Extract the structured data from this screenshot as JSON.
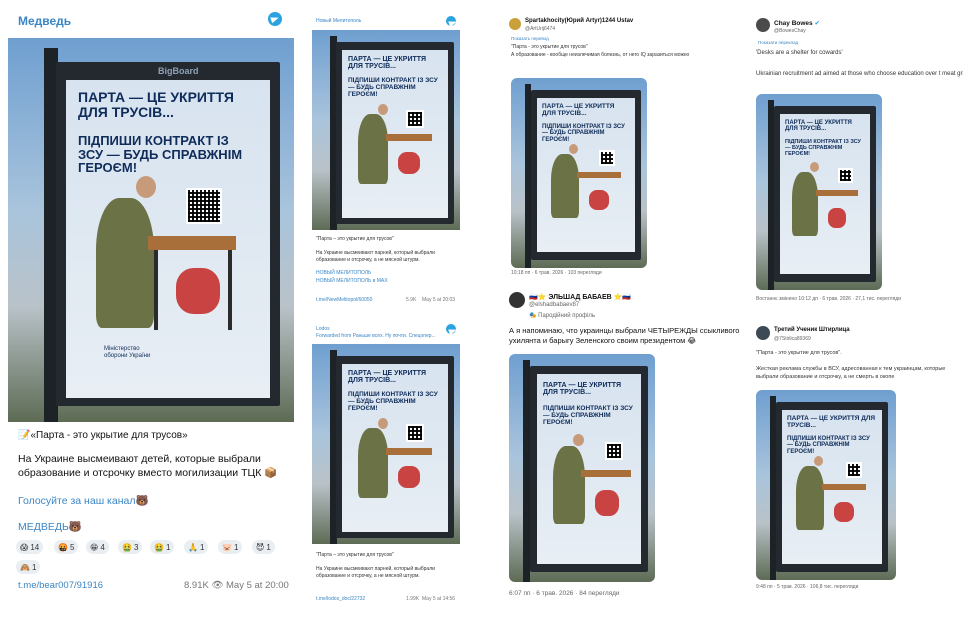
{
  "poster_text": {
    "headline": "ПАРТА — ЦЕ УКРИТТЯ ДЛЯ ТРУСІВ...",
    "sub": "ПІДПИШИ КОНТРАКТ ІЗ ЗСУ — БУДЬ СПРАВЖНІМ ГЕРОЄМ!",
    "ministry": "Міністерство оборони України",
    "board": "BigBoard"
  },
  "panel1": {
    "channel": "Медведь",
    "quote": "«Парта - это укрытие для трусов»",
    "body": "На Украине высмеивают детей, которые выбрали образование и отсрочку вместо могилизации ТЦК",
    "vote_link": "Голосуйте за наш канал",
    "signature": "МЕДВЕДЬ",
    "reactions": [
      {
        "emoji": "😱",
        "count": "14"
      },
      {
        "emoji": "🤬",
        "count": "5"
      },
      {
        "emoji": "😁",
        "count": "4"
      },
      {
        "emoji": "🤮",
        "count": "3"
      },
      {
        "emoji": "🤮",
        "count": "1"
      },
      {
        "emoji": "🙏",
        "count": "1"
      },
      {
        "emoji": "🐷",
        "count": "1"
      },
      {
        "emoji": "😈",
        "count": "1"
      },
      {
        "emoji": "🙈",
        "count": "1"
      }
    ],
    "link": "t.me/bear007/91916",
    "views": "8.91K",
    "date": "May 5 at 20:00"
  },
  "panel2": {
    "channel": "Новый Мелитополь",
    "quote": "\"Парта – это укрытие для трусов\"",
    "body": "На Украине высмеивают парней, который выбрали образование и отсрочку, а не мясной штурм.",
    "extra1": "НОВЫЙ МЕЛИТОПОЛЬ",
    "extra2": "НОВЫЙ МЕЛИТОПОЛЬ в MAX",
    "link": "t.me/NewMelitopol/60050",
    "views": "5.9K",
    "date": "May 5 at 20:03"
  },
  "panel3": {
    "channel": "Lodos",
    "forwarded": "Forwarded from Раньше всех. Ну почти. Спецопер...",
    "quote": "\"Парта – это укрытие для трусов\"",
    "body": "На Украине высмеивают парней, который выбрали образование и отсрочку, а не мясной штурм.",
    "link": "t.me/lodos_doc/22732",
    "views": "1.99K",
    "date": "May 5 at 14:56"
  },
  "panel4": {
    "author": "Spartakhocity(Юрий Artyr)1244 Ustav",
    "handle": "@ArtUrij6474",
    "translate": "Показать перевод",
    "quote": "\"Парта - это укрытие для трусов\"",
    "body": "А образование - вообще неизлечимая болезнь, от него IQ заразиться можно",
    "time": "10:18 пп · 6 трав. 2026 · 103 перегляди"
  },
  "panel5": {
    "author": "ЭЛЬШАД БАБАЕВ",
    "handle": "@elshadbabaev87",
    "parody": "Пародійний профіль",
    "body": "А я напоминаю, что украинцы выбрали ЧЕТЫРЕЖДЫ ссыкливого ухилянта и барыгу Зеленского своим президентом",
    "time": "6:07 пп · 6 трав. 2026 · 84 перегляди"
  },
  "panel6": {
    "author": "Chay Bowes",
    "handle": "@BowesChay",
    "translate": "Показати переклад",
    "quote": "'Desks are a shelter for cowards'",
    "body": "Ukrainian recruitment ad aimed at those who choose education over t meat grinder.",
    "time": "Востаннє змінено 10:12 дп · 6 трав. 2026 · 27,1 тис. перегляди"
  },
  "panel7": {
    "author": "Третий Ученик Штирлица",
    "handle": "@7Stirlica89369",
    "quote": "\"Парта - это укрытие для трусов\".",
    "body": "Жесткая реклама службы в ВСУ, адресованная к тем украинцам, которые выбрали образование и отсрочку, а не смерть в окопе",
    "time": "9:48 пп · 5 трав. 2026 · 106,8 тис. перегляди"
  }
}
